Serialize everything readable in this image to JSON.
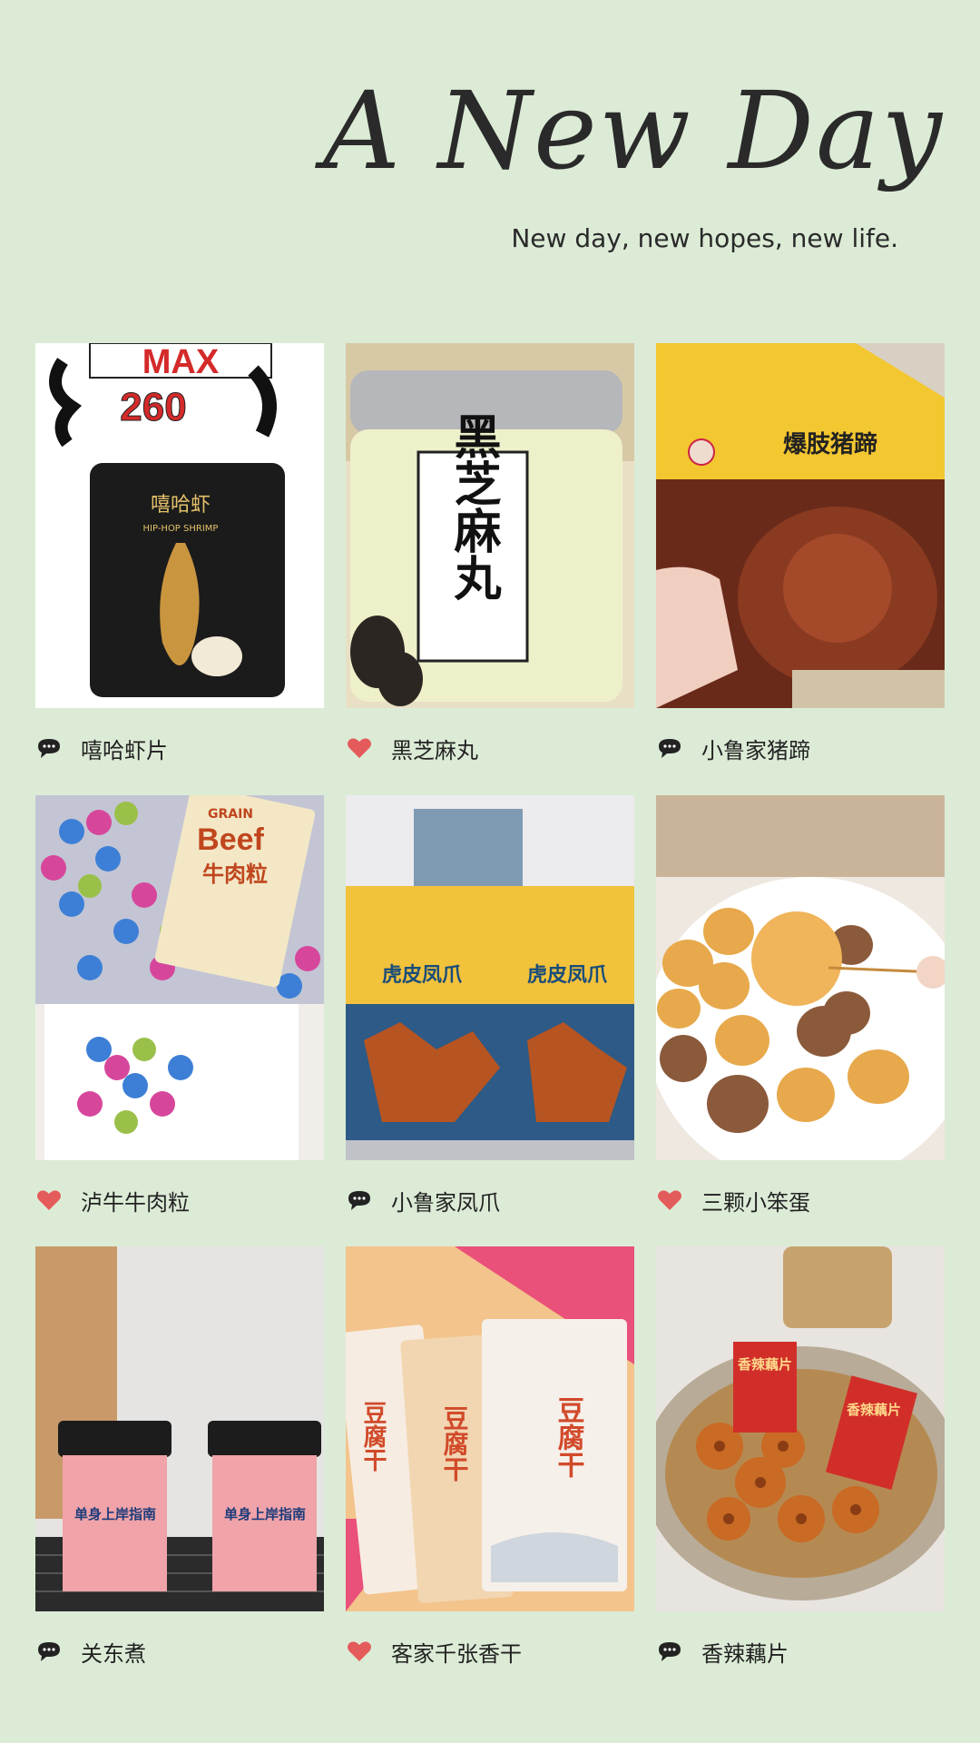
{
  "header": {
    "title": "A New Day",
    "subtitle": "New day, new hopes, new life."
  },
  "colors": {
    "background": "#dcebd6",
    "heart": "#e45b5b",
    "comment": "#222222"
  },
  "items": [
    {
      "label": "嘻哈虾片",
      "icon": "comment-icon",
      "image_texts": [
        "MAX",
        "260",
        "嘻哈虾",
        "HIP-HOP SHRIMP"
      ]
    },
    {
      "label": "黑芝麻丸",
      "icon": "heart-icon",
      "image_texts": [
        "黑芝麻丸"
      ]
    },
    {
      "label": "小鲁家猪蹄",
      "icon": "comment-icon",
      "image_texts": [
        "爆肢猪蹄"
      ]
    },
    {
      "label": "泸牛牛肉粒",
      "icon": "heart-icon",
      "image_texts": [
        "GRAIN",
        "Beef",
        "牛肉粒"
      ]
    },
    {
      "label": "小鲁家凤爪",
      "icon": "comment-icon",
      "image_texts": [
        "虎皮凤爪",
        "虎皮凤爪"
      ]
    },
    {
      "label": "三颗小笨蛋",
      "icon": "heart-icon",
      "image_texts": []
    },
    {
      "label": "关东煮",
      "icon": "comment-icon",
      "image_texts": [
        "单身上岸指南",
        "单身上岸指南"
      ]
    },
    {
      "label": "客家千张香干",
      "icon": "heart-icon",
      "image_texts": [
        "豆腐干",
        "豆腐干",
        "豆腐干"
      ]
    },
    {
      "label": "香辣藕片",
      "icon": "comment-icon",
      "image_texts": [
        "香辣藕片",
        "香辣藕片"
      ]
    }
  ]
}
